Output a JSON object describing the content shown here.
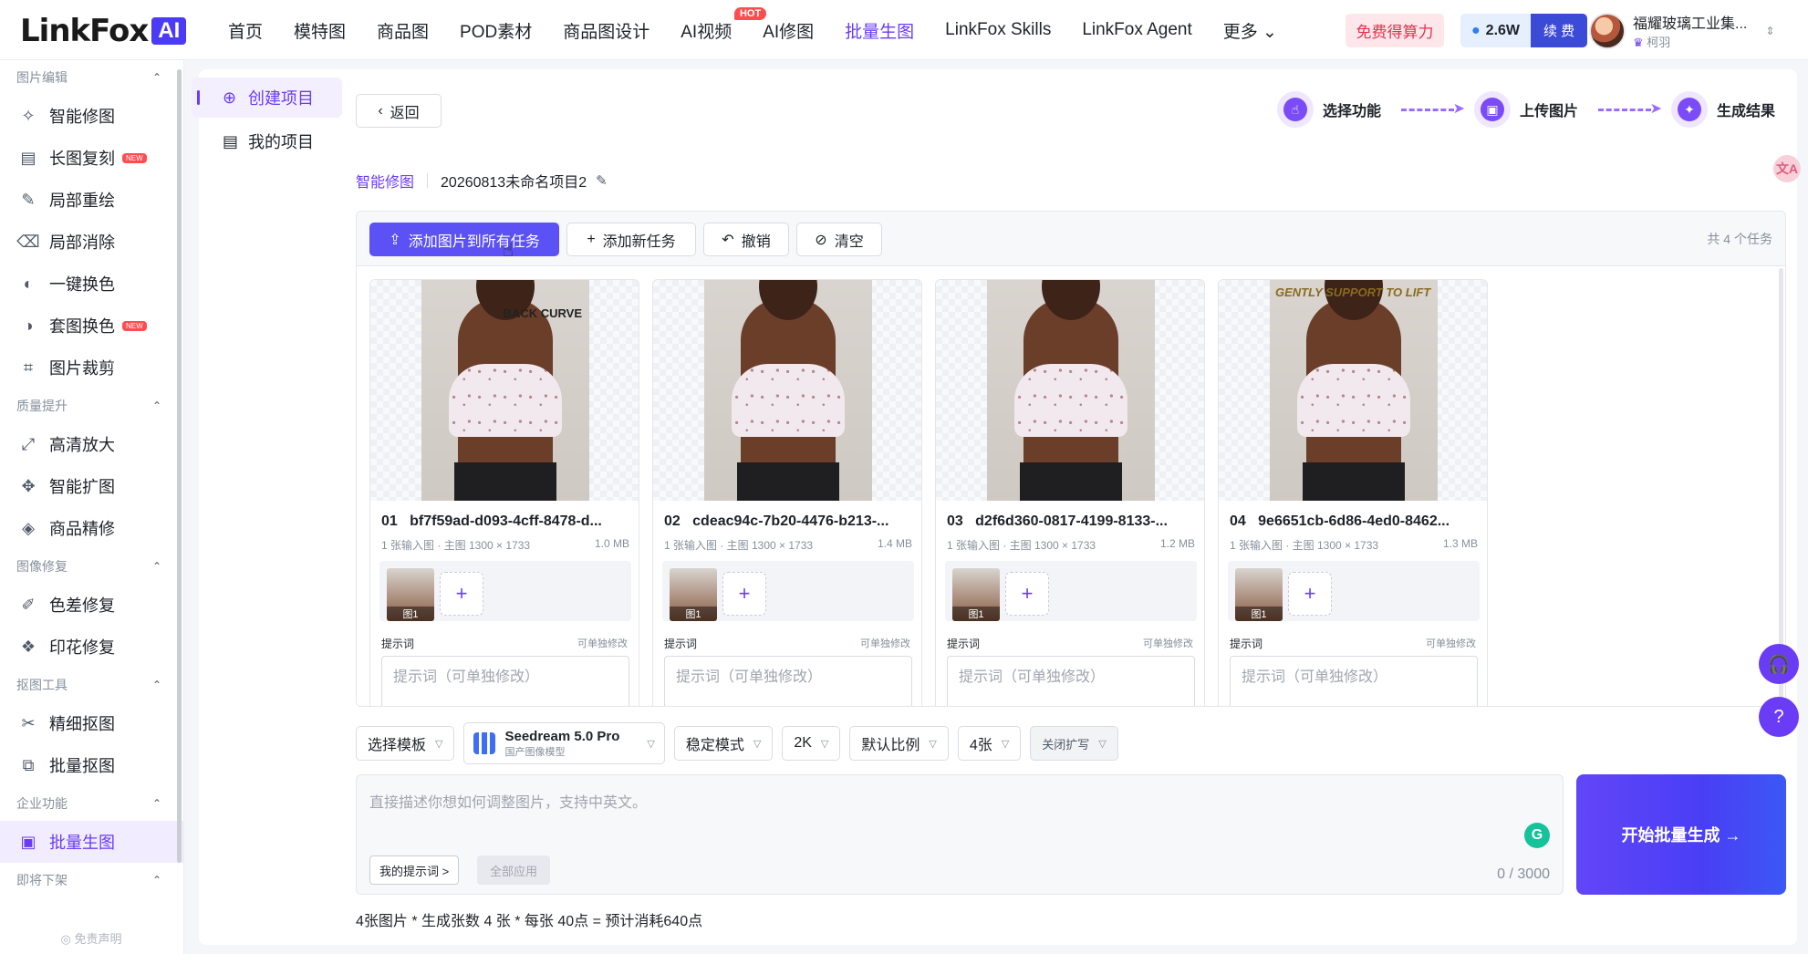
{
  "logo": {
    "text": "LinkFox",
    "badge": "AI"
  },
  "nav": {
    "items": [
      "首页",
      "模特图",
      "商品图",
      "POD素材",
      "商品图设计",
      "AI视频",
      "AI修图",
      "批量生图",
      "LinkFox Skills",
      "LinkFox Agent",
      "更多 ⌄"
    ],
    "hot_badge": "HOT",
    "free_btn": "免费得算力",
    "credit": "2.6W",
    "renew": "续 费",
    "user_name": "福耀玻璃工业集...",
    "user_sub": "柯羽"
  },
  "sidebar": {
    "groups": [
      {
        "title": "图片编辑",
        "items": [
          {
            "label": "智能修图",
            "icon": "✧"
          },
          {
            "label": "长图复刻",
            "icon": "▤",
            "badge": "NEW"
          },
          {
            "label": "局部重绘",
            "icon": "✎"
          },
          {
            "label": "局部消除",
            "icon": "⌫"
          },
          {
            "label": "一键换色",
            "icon": "◐"
          },
          {
            "label": "套图换色",
            "icon": "◑",
            "badge": "NEW"
          },
          {
            "label": "图片裁剪",
            "icon": "⌗"
          }
        ]
      },
      {
        "title": "质量提升",
        "items": [
          {
            "label": "高清放大",
            "icon": "⤢"
          },
          {
            "label": "智能扩图",
            "icon": "✥"
          },
          {
            "label": "商品精修",
            "icon": "◈"
          }
        ]
      },
      {
        "title": "图像修复",
        "items": [
          {
            "label": "色差修复",
            "icon": "✐"
          },
          {
            "label": "印花修复",
            "icon": "❖"
          }
        ]
      },
      {
        "title": "抠图工具",
        "items": [
          {
            "label": "精细抠图",
            "icon": "✂"
          },
          {
            "label": "批量抠图",
            "icon": "⧉"
          }
        ]
      },
      {
        "title": "企业功能",
        "items": [
          {
            "label": "批量生图",
            "icon": "▣",
            "active": true
          }
        ]
      },
      {
        "title": "即将下架",
        "items": []
      }
    ],
    "footer": "◎ 免责声明"
  },
  "subnav": {
    "create": "创建项目",
    "mine": "我的项目"
  },
  "back": "返回",
  "steps": [
    "选择功能",
    "上传图片",
    "生成结果"
  ],
  "breadcrumb": {
    "link": "智能修图",
    "name": "20260813未命名项目2"
  },
  "toolbar": {
    "add_all": "添加图片到所有任务",
    "add_task": "添加新任务",
    "undo": "撤销",
    "clear": "清空",
    "count": "共 4 个任务"
  },
  "cards": [
    {
      "no": "01",
      "id": "bf7f59ad-d093-4cff-8478-d...",
      "meta": "1 张输入图 · 主图 1300 × 1733",
      "size": "1.0 MB",
      "overlay": "BACK CURVE"
    },
    {
      "no": "02",
      "id": "cdeac94c-7b20-4476-b213-...",
      "meta": "1 张输入图 · 主图 1300 × 1733",
      "size": "1.4 MB"
    },
    {
      "no": "03",
      "id": "d2f6d360-0817-4199-8133-...",
      "meta": "1 张输入图 · 主图 1300 × 1733",
      "size": "1.2 MB"
    },
    {
      "no": "04",
      "id": "9e6651cb-6d86-4ed0-8462...",
      "meta": "1 张输入图 · 主图 1300 × 1733",
      "size": "1.3 MB",
      "top_text": "GENTLY SUPPORT TO LIFT"
    }
  ],
  "card_common": {
    "thumb": "图1",
    "prompt_label": "提示词",
    "prompt_tip": "可单独修改",
    "prompt_placeholder": "提示词（可单独修改）"
  },
  "settings": {
    "template": "选择模板",
    "model_name": "Seedream 5.0 Pro",
    "model_sub": "国产图像模型",
    "mode": "稳定模式",
    "resolution": "2K",
    "ratio": "默认比例",
    "count": "4张",
    "expand": "关闭扩写"
  },
  "prompt": {
    "placeholder": "直接描述你想如何调整图片，支持中英文。",
    "mine": "我的提示词 >",
    "apply": "全部应用",
    "counter": "0 / 3000"
  },
  "start": "开始批量生成 →",
  "cost": "4张图片 * 生成张数 4 张 * 每张 40点 = 预计消耗640点"
}
